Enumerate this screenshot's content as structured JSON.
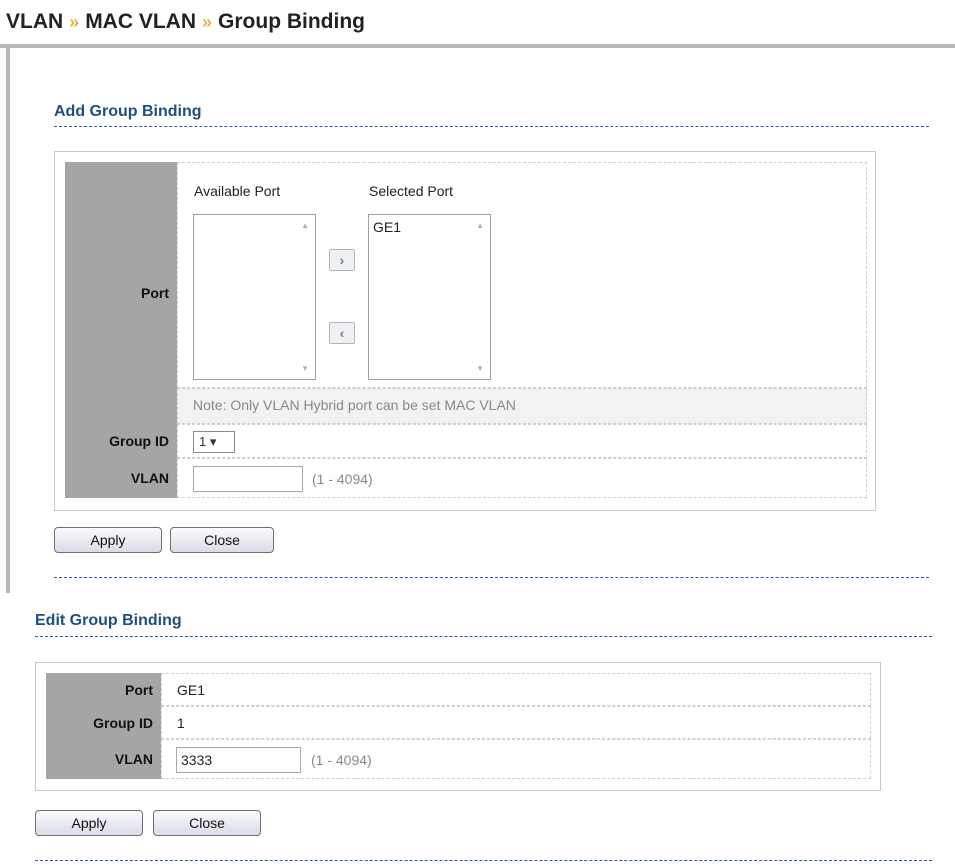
{
  "breadcrumb": {
    "level1": "VLAN",
    "level2": "MAC VLAN",
    "level3": "Group Binding",
    "separator": "»"
  },
  "add": {
    "section_title": "Add Group Binding",
    "port_label": "Port",
    "available_port_label": "Available Port",
    "selected_port_label": "Selected Port",
    "available_ports": [],
    "selected_ports": [
      "GE1"
    ],
    "move_right": "›",
    "move_left": "‹",
    "note": "Note: Only VLAN Hybrid port can be set MAC VLAN",
    "group_id_label": "Group ID",
    "group_id_value": "1 ▾",
    "vlan_label": "VLAN",
    "vlan_value": "",
    "vlan_range": "(1 - 4094)",
    "apply_label": "Apply",
    "close_label": "Close"
  },
  "edit": {
    "section_title": "Edit Group Binding",
    "port_label": "Port",
    "port_value": "GE1",
    "group_id_label": "Group ID",
    "group_id_value": "1",
    "vlan_label": "VLAN",
    "vlan_value": "3333",
    "vlan_range": "(1 - 4094)",
    "apply_label": "Apply",
    "close_label": "Close"
  },
  "colors": {
    "section_title": "#1f4f7a",
    "label_bg": "#a5a5a5",
    "separator": "#e6b54a"
  }
}
